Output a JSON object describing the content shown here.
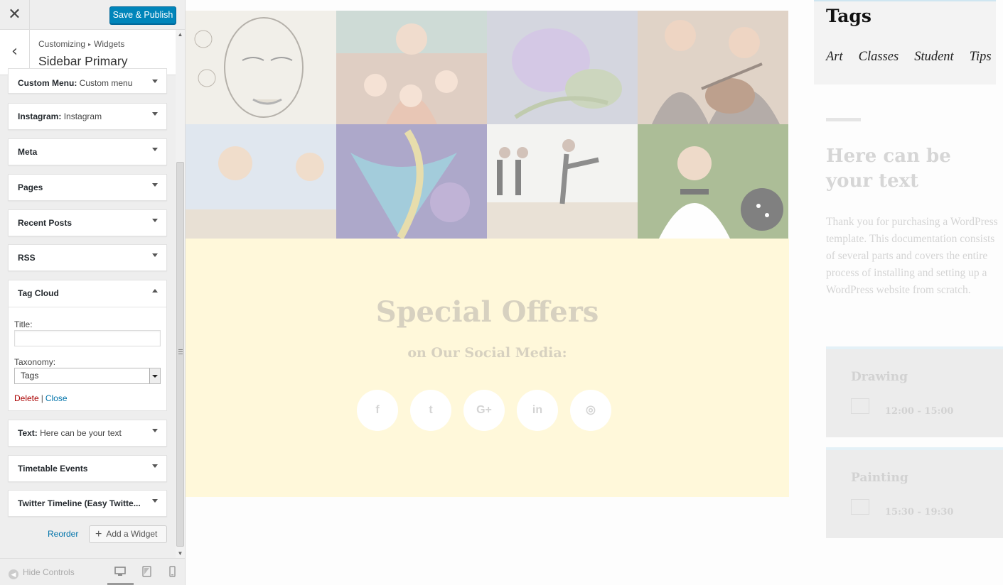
{
  "topbar": {
    "close_glyph": "✕",
    "save_label": "Save & Publish"
  },
  "section": {
    "back_glyph": "‹",
    "breadcrumb_root": "Customizing",
    "breadcrumb_arrow": "▸",
    "breadcrumb_current": "Widgets",
    "title": "Sidebar Primary"
  },
  "widgets": [
    {
      "title": "Custom Menu:",
      "subtitle": "Custom menu"
    },
    {
      "title": "Instagram:",
      "subtitle": "Instagram"
    },
    {
      "title": "Meta",
      "subtitle": ""
    },
    {
      "title": "Pages",
      "subtitle": ""
    },
    {
      "title": "Recent Posts",
      "subtitle": ""
    },
    {
      "title": "RSS",
      "subtitle": ""
    },
    {
      "title": "Text:",
      "subtitle": "Here can be your text"
    },
    {
      "title": "Timetable Events",
      "subtitle": ""
    },
    {
      "title": "Twitter Timeline (Easy Twitte...",
      "subtitle": ""
    }
  ],
  "tag_cloud": {
    "title": "Tag Cloud",
    "title_label": "Title:",
    "title_value": "",
    "taxonomy_label": "Taxonomy:",
    "taxonomy_value": "Tags",
    "delete_label": "Delete",
    "separator": "|",
    "close_label": "Close"
  },
  "actions": {
    "reorder_label": "Reorder",
    "add_plus": "+",
    "add_widget_label": "Add a Widget"
  },
  "footer": {
    "hide_glyph": "◀",
    "hide_label": "Hide Controls"
  },
  "scrollbar": {
    "up": "▲",
    "down": "▼"
  },
  "preview": {
    "offers_title": "Special Offers",
    "offers_subtitle": "on Our Social Media:",
    "social": [
      "f",
      "t",
      "G+",
      "in",
      "◎"
    ],
    "tags_heading": "Tags",
    "tags": [
      "Art",
      "Classes",
      "Student",
      "Tips"
    ],
    "text_title": "Here can be your text",
    "text_body": "Thank you for purchasing a WordPress template. This documentation consists of several parts and covers the entire process of installing and setting up a WordPress website from scratch.",
    "events": [
      {
        "name": "Drawing",
        "time": "12:00 - 15:00"
      },
      {
        "name": "Painting",
        "time": "15:30 - 19:30"
      }
    ]
  },
  "colors": {
    "accent": "#0085ba",
    "offers_bg": "#fff8da",
    "delete": "#aa0000",
    "link": "#0073aa"
  }
}
